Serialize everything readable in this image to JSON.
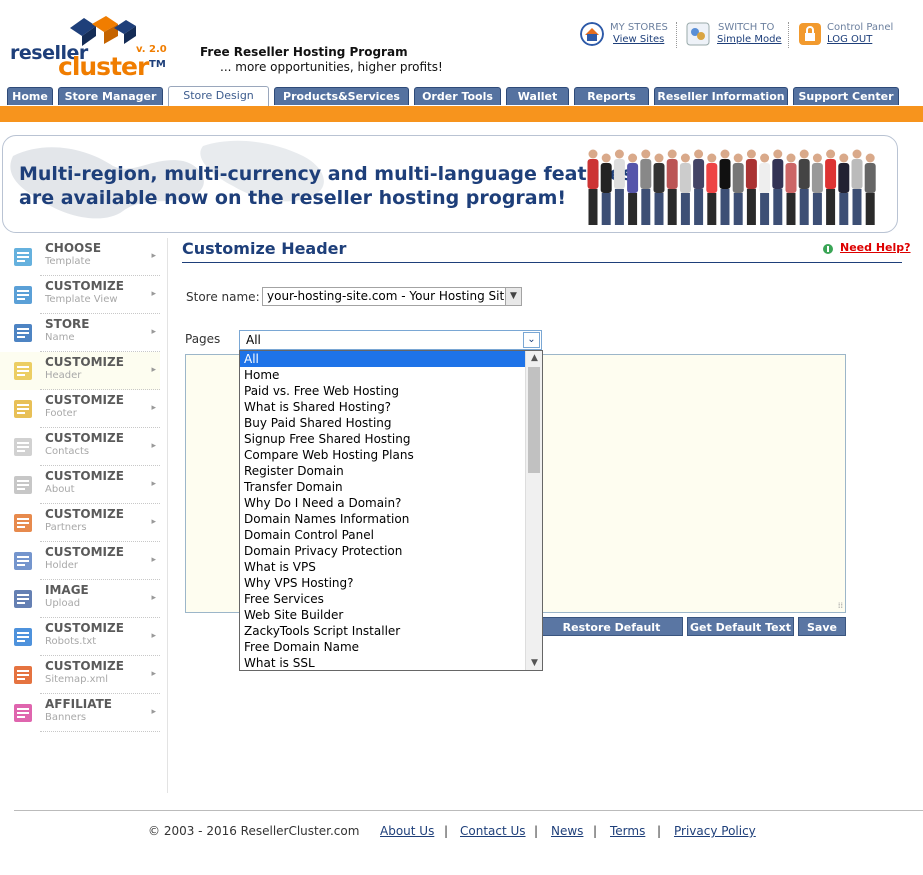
{
  "brand": {
    "word1": "reseller",
    "word2": "cluster",
    "tm": "TM",
    "version": "v. 2.0",
    "tagline": "Free Reseller Hosting Program",
    "subtagline": "... more opportunities, higher profits!"
  },
  "toplinks": {
    "my_stores": "MY STORES",
    "view_sites": "View Sites",
    "switch_to": "SWITCH TO",
    "simple_mode": "Simple Mode",
    "control_panel": "Control Panel",
    "logout": "LOG OUT"
  },
  "nav": {
    "tabs": [
      "Home",
      "Store Manager",
      "Store Design",
      "Products&Services",
      "Order Tools",
      "Wallet",
      "Reports",
      "Reseller Information",
      "Support Center"
    ],
    "active": "Store Design"
  },
  "banner": {
    "line1": "Multi-region, multi-currency and multi-language features",
    "line2": "are available now on the reseller hosting program!"
  },
  "sidebar": {
    "items": [
      {
        "title": "CHOOSE",
        "sub": "Template",
        "icon": "template-icon"
      },
      {
        "title": "CUSTOMIZE",
        "sub": "Template View",
        "icon": "template-view-icon"
      },
      {
        "title": "STORE",
        "sub": "Name",
        "icon": "monitor-icon"
      },
      {
        "title": "CUSTOMIZE",
        "sub": "Header",
        "icon": "header-icon"
      },
      {
        "title": "CUSTOMIZE",
        "sub": "Footer",
        "icon": "footer-icon"
      },
      {
        "title": "CUSTOMIZE",
        "sub": "Contacts",
        "icon": "contacts-icon"
      },
      {
        "title": "CUSTOMIZE",
        "sub": "About",
        "icon": "about-icon"
      },
      {
        "title": "CUSTOMIZE",
        "sub": "Partners",
        "icon": "partners-icon"
      },
      {
        "title": "CUSTOMIZE",
        "sub": "Holder",
        "icon": "holder-icon"
      },
      {
        "title": "IMAGE",
        "sub": "Upload",
        "icon": "image-upload-icon"
      },
      {
        "title": "CUSTOMIZE",
        "sub": "Robots.txt",
        "icon": "robot-icon"
      },
      {
        "title": "CUSTOMIZE",
        "sub": "Sitemap.xml",
        "icon": "sitemap-icon"
      },
      {
        "title": "AFFILIATE",
        "sub": "Banners",
        "icon": "banners-icon"
      }
    ]
  },
  "main": {
    "title": "Customize Header",
    "help": "Need Help?",
    "store_label": "Store name:",
    "store_value": "your-hosting-site.com - Your Hosting Site",
    "pages_label": "Pages",
    "pages_value": "All",
    "pages_options": [
      "All",
      "Home",
      "Paid vs. Free Web Hosting",
      "What is Shared Hosting?",
      "Buy Paid Shared Hosting",
      "Signup Free Shared Hosting",
      "Compare Web Hosting Plans",
      "Register Domain",
      "Transfer Domain",
      "Why Do I Need a Domain?",
      "Domain Names Information",
      "Domain Control Panel",
      "Domain Privacy Protection",
      "What is VPS",
      "Why VPS Hosting?",
      "Free Services",
      "Web Site Builder",
      "ZackyTools Script Installer",
      "Free Domain Name",
      "What is SSL"
    ],
    "btn_restore": "Restore Default Header",
    "btn_default": "Get Default Text",
    "btn_save": "Save"
  },
  "footer": {
    "copyright": "© 2003 - 2016 ResellerCluster.com",
    "links": [
      "About Us",
      "Contact Us",
      "News",
      "Terms",
      "Privacy Policy"
    ],
    "sep": "|"
  },
  "colors": {
    "navy": "#1e3f7a",
    "orange": "#f7941d",
    "tab": "#5572a0",
    "highlight": "#1e73e8"
  }
}
